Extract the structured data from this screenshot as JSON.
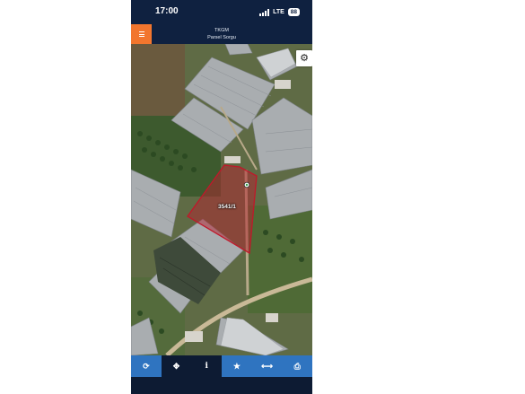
{
  "status_bar": {
    "time": "17:00",
    "network": "LTE",
    "battery": "88"
  },
  "header": {
    "title": "TKGM",
    "subtitle": "Parsel Sorgu",
    "menu_icon": "hamburger-menu-icon"
  },
  "map": {
    "settings_icon": "gear-icon",
    "parcel_label": "3541/1",
    "parcel_color": "#b4232f"
  },
  "toolbar": {
    "items": [
      {
        "name": "refresh-button",
        "icon": "refresh-icon",
        "glyph": "⟳",
        "active": false
      },
      {
        "name": "locate-button",
        "icon": "crosshair-icon",
        "glyph": "✥",
        "active": true
      },
      {
        "name": "info-button",
        "icon": "info-icon",
        "glyph": "i",
        "active": true
      },
      {
        "name": "favorite-button",
        "icon": "star-icon",
        "glyph": "★",
        "active": false
      },
      {
        "name": "measure-button",
        "icon": "measure-arrows-icon",
        "glyph": "⟷",
        "active": false
      },
      {
        "name": "print-button",
        "icon": "printer-icon",
        "glyph": "⎙",
        "active": false
      }
    ]
  },
  "colors": {
    "header_bg": "#0f2140",
    "menu_accent": "#f2762e",
    "toolbar_blue": "#2f74c0"
  }
}
